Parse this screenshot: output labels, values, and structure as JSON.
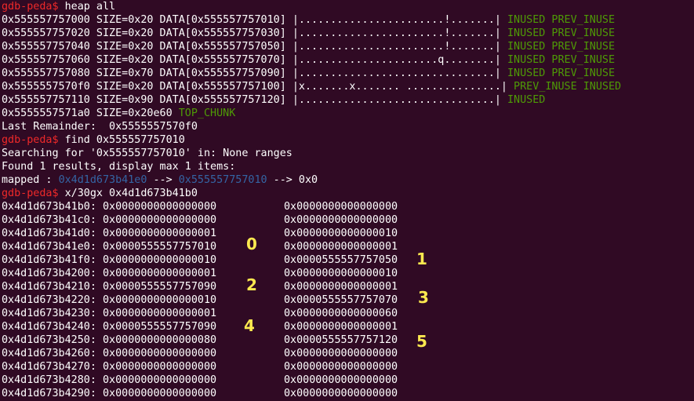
{
  "prompt": "gdb-peda$",
  "commands": {
    "heap": "heap all",
    "find": "find 0x555557757010",
    "examine": "x/30gx 0x4d1d673b41b0"
  },
  "heap_chunks": [
    {
      "text": "0x555557757000 SIZE=0x20 DATA[0x555557757010] |.......................!.......|",
      "flags": "INUSED PREV_INUSE"
    },
    {
      "text": "0x555557757020 SIZE=0x20 DATA[0x555557757030] |.......................!.......|",
      "flags": "INUSED PREV_INUSE"
    },
    {
      "text": "0x555557757040 SIZE=0x20 DATA[0x555557757050] |.......................!.......|",
      "flags": "INUSED PREV_INUSE"
    },
    {
      "text": "0x555557757060 SIZE=0x20 DATA[0x555557757070] |......................q........|",
      "flags": "INUSED PREV_INUSE"
    },
    {
      "text": "0x555557757080 SIZE=0x70 DATA[0x555557757090] |...............................|",
      "flags": "INUSED PREV_INUSE"
    },
    {
      "text": "0x5555557570f0 SIZE=0x20 DATA[0x555557757100] |x.......x....... ...............|",
      "flags": "PREV_INUSE INUSED"
    },
    {
      "text": "0x555557757110 SIZE=0x90 DATA[0x555557757120] |...............................|",
      "flags": "INUSED"
    },
    {
      "text": "0x5555557571a0 SIZE=0x20e60",
      "flags": "TOP_CHUNK"
    }
  ],
  "last_remainder": "Last Remainder:  0x5555557570f0",
  "find_output": {
    "searching": "Searching for '0x555557757010' in: None ranges",
    "found": "Found 1 results, display max 1 items:",
    "mapped_prefix": "mapped : ",
    "mapped_addr": "0x4d1d673b41e0",
    "arrow1": " --> ",
    "target": "0x555557757010",
    "arrow2": " --> 0x0"
  },
  "memory_rows": [
    {
      "addr": "0x4d1d673b41b0:",
      "v1": "0x0000000000000000",
      "v2": "0x0000000000000000"
    },
    {
      "addr": "0x4d1d673b41c0:",
      "v1": "0x0000000000000000",
      "v2": "0x0000000000000000"
    },
    {
      "addr": "0x4d1d673b41d0:",
      "v1": "0x0000000000000001",
      "v2": "0x0000000000000010"
    },
    {
      "addr": "0x4d1d673b41e0:",
      "v1": "0x0000555557757010",
      "v2": "0x0000000000000001"
    },
    {
      "addr": "0x4d1d673b41f0:",
      "v1": "0x0000000000000010",
      "v2": "0x0000555557757050"
    },
    {
      "addr": "0x4d1d673b4200:",
      "v1": "0x0000000000000001",
      "v2": "0x0000000000000010"
    },
    {
      "addr": "0x4d1d673b4210:",
      "v1": "0x0000555557757090",
      "v2": "0x0000000000000001"
    },
    {
      "addr": "0x4d1d673b4220:",
      "v1": "0x0000000000000010",
      "v2": "0x0000555557757070"
    },
    {
      "addr": "0x4d1d673b4230:",
      "v1": "0x0000000000000001",
      "v2": "0x0000000000000060"
    },
    {
      "addr": "0x4d1d673b4240:",
      "v1": "0x0000555557757090",
      "v2": "0x0000000000000001"
    },
    {
      "addr": "0x4d1d673b4250:",
      "v1": "0x0000000000000080",
      "v2": "0x0000555557757120"
    },
    {
      "addr": "0x4d1d673b4260:",
      "v1": "0x0000000000000000",
      "v2": "0x0000000000000000"
    },
    {
      "addr": "0x4d1d673b4270:",
      "v1": "0x0000000000000000",
      "v2": "0x0000000000000000"
    },
    {
      "addr": "0x4d1d673b4280:",
      "v1": "0x0000000000000000",
      "v2": "0x0000000000000000"
    },
    {
      "addr": "0x4d1d673b4290:",
      "v1": "0x0000000000000000",
      "v2": "0x0000000000000000"
    }
  ],
  "annotations": [
    "0",
    "1",
    "2",
    "3",
    "4",
    "5"
  ],
  "colors": {
    "background": "#300a24",
    "prompt": "#ef2929",
    "flags": "#4e9a06",
    "address_link": "#3465a4",
    "annotation": "#fce94f"
  }
}
